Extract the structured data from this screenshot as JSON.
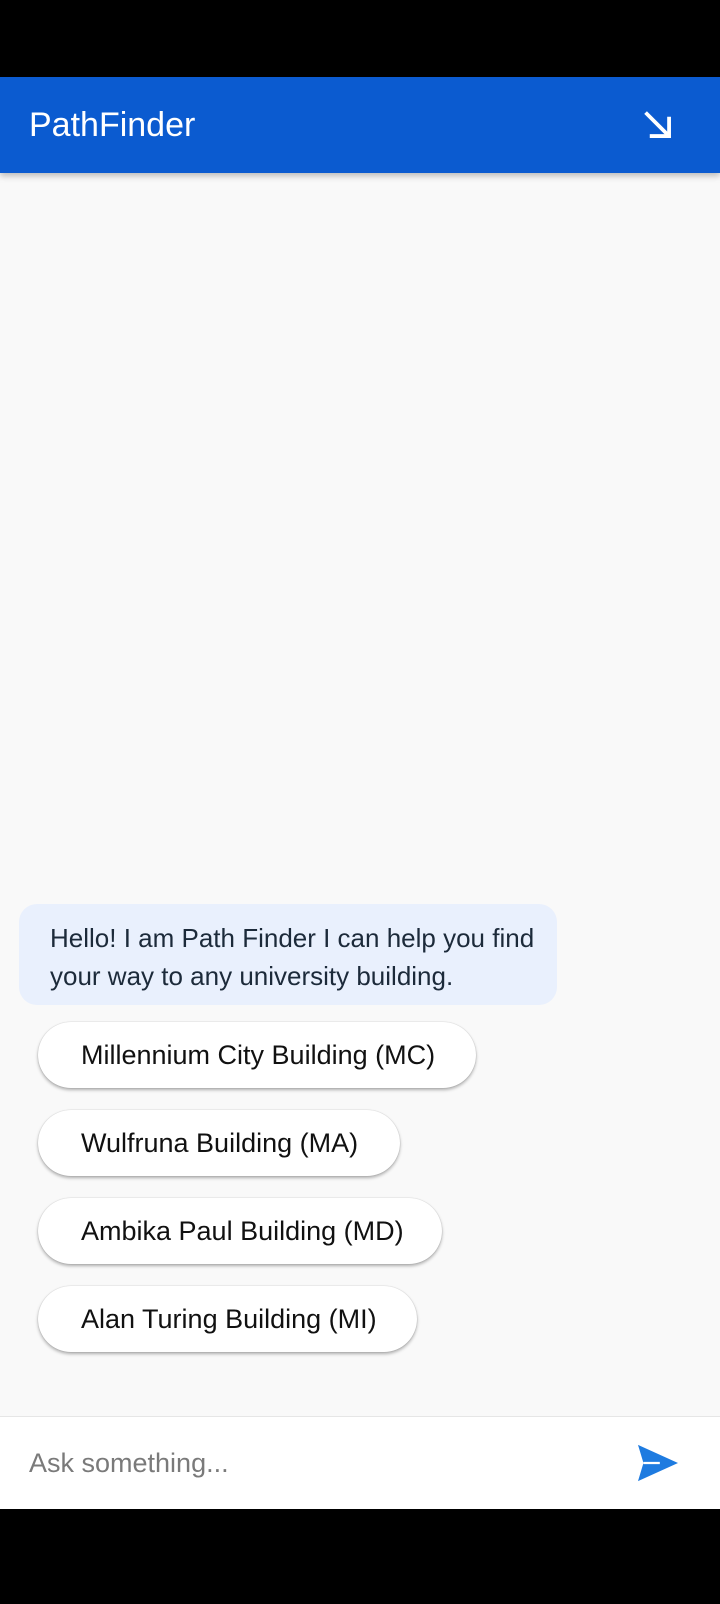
{
  "app_bar": {
    "title": "PathFinder",
    "minimize_icon": "arrow-down-right-icon",
    "color": "#0b5bd0"
  },
  "chat": {
    "bot_message": "Hello! I am Path Finder I can help you find your way to any university building.",
    "bubble_color": "#e9f0fd",
    "quick_replies": [
      {
        "label": "Millennium City Building (MC)"
      },
      {
        "label": "Wulfruna Building (MA)"
      },
      {
        "label": "Ambika Paul Building (MD)"
      },
      {
        "label": "Alan Turing Building (MI)"
      }
    ]
  },
  "input": {
    "placeholder": "Ask something...",
    "value": "",
    "send_icon": "send-icon",
    "send_color": "#1e7be0"
  }
}
